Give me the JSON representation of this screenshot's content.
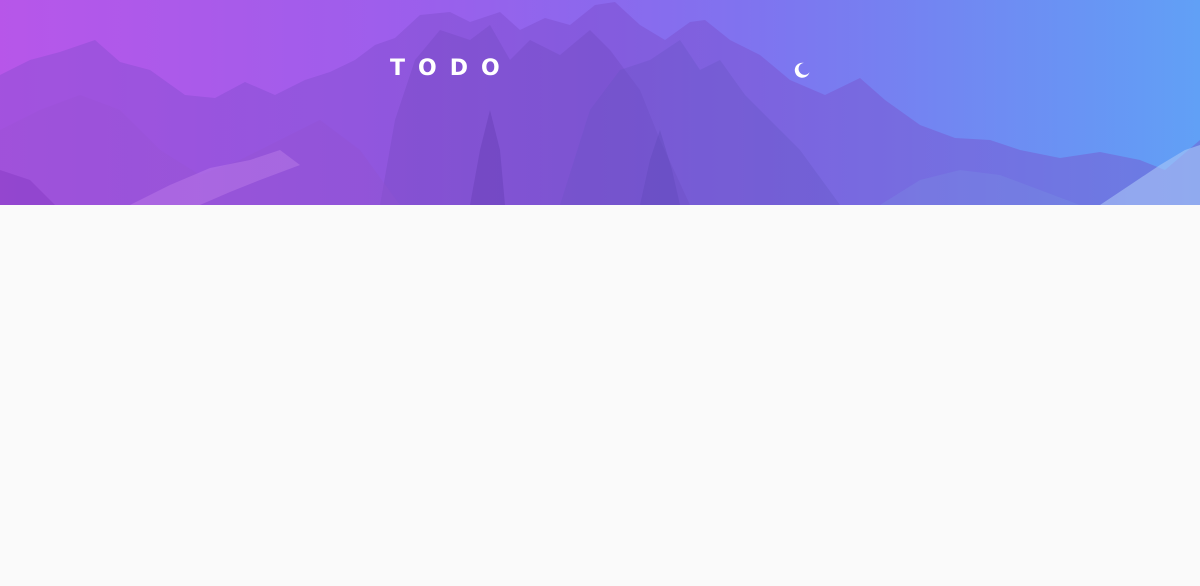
{
  "header": {
    "title": "TODO",
    "theme_toggle_icon": "moon-icon"
  },
  "colors": {
    "gradient_start": "#b35ae8",
    "gradient_end": "#63a0f6",
    "page_background": "#fafafa",
    "title_color": "#ffffff"
  }
}
